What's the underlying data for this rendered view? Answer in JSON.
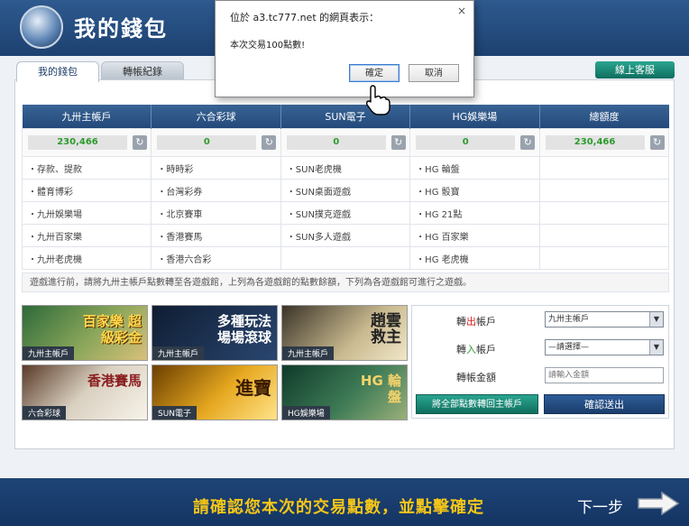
{
  "header": {
    "title": "我的錢包"
  },
  "tabs": [
    {
      "label": "我的錢包"
    },
    {
      "label": "轉帳紀錄"
    }
  ],
  "service_button": "線上客服",
  "wallets": [
    {
      "name": "九卅主帳戶",
      "balance": "230,466"
    },
    {
      "name": "六合彩球",
      "balance": "0"
    },
    {
      "name": "SUN電子",
      "balance": "0"
    },
    {
      "name": "HG娛樂場",
      "balance": "0"
    },
    {
      "name": "總額度",
      "balance": "230,466"
    }
  ],
  "game_rows": [
    [
      "・存款、提款",
      "・時時彩",
      "・SUN老虎機",
      "・HG 輪盤",
      ""
    ],
    [
      "・體育博彩",
      "・台灣彩券",
      "・SUN桌面遊戲",
      "・HG 骰寶",
      ""
    ],
    [
      "・九卅娛樂場",
      "・北京賽車",
      "・SUN撲克遊戲",
      "・HG 21點",
      ""
    ],
    [
      "・九卅百家樂",
      "・香港賽馬",
      "・SUN多人遊戲",
      "・HG 百家樂",
      ""
    ],
    [
      "・九卅老虎機",
      "・香港六合彩",
      "",
      "・HG 老虎機",
      ""
    ]
  ],
  "notice": "遊戲進行前，請將九卅主帳戶點數轉至各遊戲館，上列為各遊戲館的點數餘額，下列為各遊戲館可進行之遊戲。",
  "games": [
    {
      "title": "百家樂 超級彩金",
      "caption": "九卅主帳戶"
    },
    {
      "title": "多種玩法 場場滾球",
      "caption": "九卅主帳戶"
    },
    {
      "title": "趙雲 救主",
      "caption": "九卅主帳戶"
    },
    {
      "title": "香港賽馬",
      "caption": "六合彩球"
    },
    {
      "title": "進寶",
      "caption": "SUN電子"
    },
    {
      "title": "HG 輪盤",
      "caption": "HG娛樂場"
    }
  ],
  "transfer": {
    "from_label": "轉出帳戶",
    "from_label_accent": "出",
    "from_value": "九卅主帳戶",
    "to_label": "轉入帳戶",
    "to_label_accent": "入",
    "to_value": "—請選擇—",
    "amount_label": "轉帳金額",
    "amount_placeholder": "請輸入金額",
    "transfer_all_button": "將全部點數轉回主帳戶",
    "confirm_button": "確認送出"
  },
  "footer": {
    "message": "請確認您本次的交易點數，並點擊確定",
    "next": "下一步"
  },
  "dialog": {
    "title": "位於 a3.tc777.net 的網頁表示：",
    "message": "本次交易100點數!",
    "ok": "確定",
    "cancel": "取消",
    "close": "×"
  },
  "colors": {
    "header": "#2e5a8f",
    "accent_green": "#2aa590",
    "balance": "#2d9a2d",
    "footer_text": "#f5c518"
  }
}
